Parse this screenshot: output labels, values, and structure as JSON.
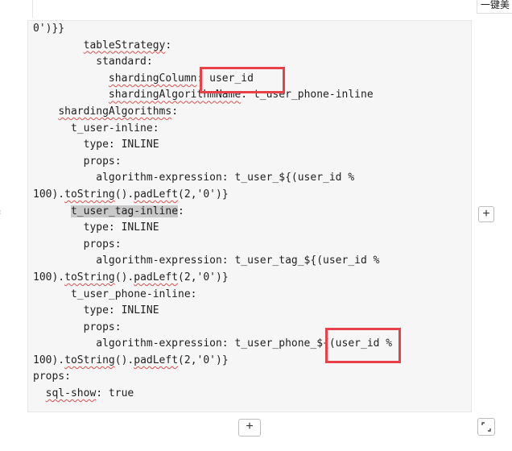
{
  "toolbar": {
    "beautify_label": "一键美"
  },
  "controls": {
    "add_symbol": "+"
  },
  "code_lines": [
    [
      {
        "t": "0')}}"
      }
    ],
    [
      {
        "t": "        "
      },
      {
        "t": "tableStrategy",
        "w": true
      },
      {
        "t": ":"
      }
    ],
    [
      {
        "t": "          standard:"
      }
    ],
    [
      {
        "t": "            "
      },
      {
        "t": "shardingColumn",
        "w": true
      },
      {
        "t": ": user_id"
      }
    ],
    [
      {
        "t": "            "
      },
      {
        "t": "shardingAlgorithmName",
        "w": true
      },
      {
        "t": ": t_user_phone-inline"
      }
    ],
    [
      {
        "t": "    "
      },
      {
        "t": "shardingAlgorithms",
        "w": true
      },
      {
        "t": ":"
      }
    ],
    [
      {
        "t": "      t_user-inline:"
      }
    ],
    [
      {
        "t": "        type: INLINE"
      }
    ],
    [
      {
        "t": "        props:"
      }
    ],
    [
      {
        "t": "          algorithm-expression: t_user_${(user_id %"
      }
    ],
    [
      {
        "t": "100)."
      },
      {
        "t": "toString",
        "w": true
      },
      {
        "t": "()."
      },
      {
        "t": "padLeft",
        "w": true
      },
      {
        "t": "(2,'0')}"
      }
    ],
    [
      {
        "t": "      "
      },
      {
        "t": "t_user_tag-inline",
        "sel": true
      },
      {
        "t": ":"
      }
    ],
    [
      {
        "t": "        type: INLINE"
      }
    ],
    [
      {
        "t": "        props:"
      }
    ],
    [
      {
        "t": "          algorithm-expression: t_user_tag_${(user_id %"
      }
    ],
    [
      {
        "t": "100)."
      },
      {
        "t": "toString",
        "w": true
      },
      {
        "t": "()."
      },
      {
        "t": "padLeft",
        "w": true
      },
      {
        "t": "(2,'0')}"
      }
    ],
    [
      {
        "t": "      t_user_phone-inline:"
      }
    ],
    [
      {
        "t": "        type: INLINE"
      }
    ],
    [
      {
        "t": "        props:"
      }
    ],
    [
      {
        "t": "          algorithm-expression: t_user_phone_${(user_id %"
      }
    ],
    [
      {
        "t": "100)."
      },
      {
        "t": "toString",
        "w": true
      },
      {
        "t": "()."
      },
      {
        "t": "padLeft",
        "w": true
      },
      {
        "t": "(2,'0')}"
      }
    ],
    [
      {
        "t": "props:"
      }
    ],
    [
      {
        "t": "  "
      },
      {
        "t": "sql-show",
        "w": true
      },
      {
        "t": ": true"
      }
    ]
  ],
  "highlight_color": "#e8414a"
}
